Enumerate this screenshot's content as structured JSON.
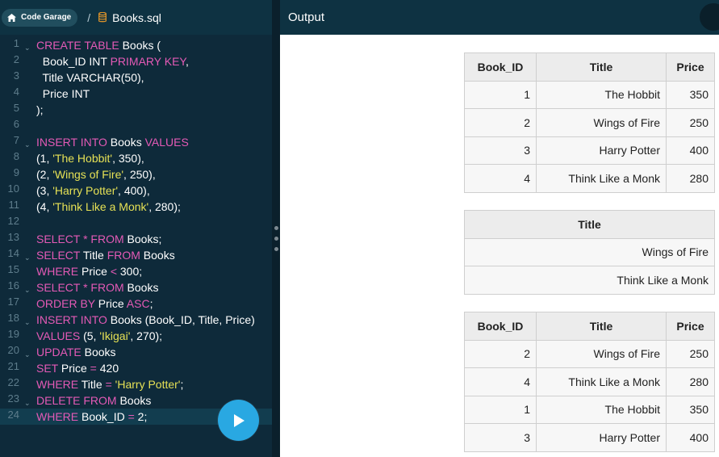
{
  "editor": {
    "project": "Code Garage",
    "separator": "/",
    "file_name": "Books.sql",
    "run_button_label": "Run",
    "active_line": 24
  },
  "code_lines": [
    {
      "n": "1",
      "fold": true,
      "tokens": [
        [
          "kw",
          "CREATE TABLE"
        ],
        [
          "t",
          " Books ("
        ]
      ]
    },
    {
      "n": "2",
      "fold": false,
      "tokens": [
        [
          "t",
          "  Book_ID INT "
        ],
        [
          "kw",
          "PRIMARY KEY"
        ],
        [
          "t",
          ","
        ]
      ]
    },
    {
      "n": "3",
      "fold": false,
      "tokens": [
        [
          "t",
          "  Title VARCHAR(50),"
        ]
      ]
    },
    {
      "n": "4",
      "fold": false,
      "tokens": [
        [
          "t",
          "  Price INT"
        ]
      ]
    },
    {
      "n": "5",
      "fold": false,
      "tokens": [
        [
          "t",
          ");"
        ]
      ]
    },
    {
      "n": "6",
      "fold": false,
      "tokens": []
    },
    {
      "n": "7",
      "fold": true,
      "tokens": [
        [
          "kw",
          "INSERT INTO"
        ],
        [
          "t",
          " Books "
        ],
        [
          "kw",
          "VALUES"
        ]
      ]
    },
    {
      "n": "8",
      "fold": false,
      "tokens": [
        [
          "t",
          "(1, "
        ],
        [
          "str",
          "'The Hobbit'"
        ],
        [
          "t",
          ", 350),"
        ]
      ]
    },
    {
      "n": "9",
      "fold": false,
      "tokens": [
        [
          "t",
          "(2, "
        ],
        [
          "str",
          "'Wings of Fire'"
        ],
        [
          "t",
          ", 250),"
        ]
      ]
    },
    {
      "n": "10",
      "fold": false,
      "tokens": [
        [
          "t",
          "(3, "
        ],
        [
          "str",
          "'Harry Potter'"
        ],
        [
          "t",
          ", 400),"
        ]
      ]
    },
    {
      "n": "11",
      "fold": false,
      "tokens": [
        [
          "t",
          "(4, "
        ],
        [
          "str",
          "'Think Like a Monk'"
        ],
        [
          "t",
          ", 280);"
        ]
      ]
    },
    {
      "n": "12",
      "fold": false,
      "tokens": []
    },
    {
      "n": "13",
      "fold": false,
      "tokens": [
        [
          "kw",
          "SELECT * FROM"
        ],
        [
          "t",
          " Books;"
        ]
      ]
    },
    {
      "n": "14",
      "fold": true,
      "tokens": [
        [
          "kw",
          "SELECT"
        ],
        [
          "t",
          " Title "
        ],
        [
          "kw",
          "FROM"
        ],
        [
          "t",
          " Books"
        ]
      ]
    },
    {
      "n": "15",
      "fold": false,
      "tokens": [
        [
          "kw",
          "WHERE"
        ],
        [
          "t",
          " Price "
        ],
        [
          "kw",
          "<"
        ],
        [
          "t",
          " 300;"
        ]
      ]
    },
    {
      "n": "16",
      "fold": true,
      "tokens": [
        [
          "kw",
          "SELECT * FROM"
        ],
        [
          "t",
          " Books"
        ]
      ]
    },
    {
      "n": "17",
      "fold": false,
      "tokens": [
        [
          "kw",
          "ORDER BY"
        ],
        [
          "t",
          " Price "
        ],
        [
          "kw",
          "ASC"
        ],
        [
          "t",
          ";"
        ]
      ]
    },
    {
      "n": "18",
      "fold": true,
      "tokens": [
        [
          "kw",
          "INSERT INTO"
        ],
        [
          "t",
          " Books (Book_ID, Title, Price)"
        ]
      ]
    },
    {
      "n": "19",
      "fold": false,
      "tokens": [
        [
          "kw",
          "VALUES"
        ],
        [
          "t",
          " (5, "
        ],
        [
          "str",
          "'Ikigai'"
        ],
        [
          "t",
          ", 270);"
        ]
      ]
    },
    {
      "n": "20",
      "fold": true,
      "tokens": [
        [
          "kw",
          "UPDATE"
        ],
        [
          "t",
          " Books"
        ]
      ]
    },
    {
      "n": "21",
      "fold": false,
      "tokens": [
        [
          "kw",
          "SET"
        ],
        [
          "t",
          " Price "
        ],
        [
          "kw",
          "="
        ],
        [
          "t",
          " 420"
        ]
      ]
    },
    {
      "n": "22",
      "fold": false,
      "tokens": [
        [
          "kw",
          "WHERE"
        ],
        [
          "t",
          " Title "
        ],
        [
          "kw",
          "="
        ],
        [
          "t",
          " "
        ],
        [
          "str",
          "'Harry Potter'"
        ],
        [
          "t",
          ";"
        ]
      ]
    },
    {
      "n": "23",
      "fold": true,
      "tokens": [
        [
          "kw",
          "DELETE FROM"
        ],
        [
          "t",
          " Books"
        ]
      ]
    },
    {
      "n": "24",
      "fold": false,
      "tokens": [
        [
          "kw",
          "WHERE"
        ],
        [
          "t",
          " Book_ID "
        ],
        [
          "kw",
          "="
        ],
        [
          "t",
          " 2;"
        ]
      ]
    }
  ],
  "output": {
    "title": "Output",
    "table1": {
      "headers": [
        "Book_ID",
        "Title",
        "Price"
      ],
      "rows": [
        [
          "1",
          "The Hobbit",
          "350"
        ],
        [
          "2",
          "Wings of Fire",
          "250"
        ],
        [
          "3",
          "Harry Potter",
          "400"
        ],
        [
          "4",
          "Think Like a Monk",
          "280"
        ]
      ]
    },
    "table2": {
      "headers": [
        "Title"
      ],
      "rows": [
        [
          "Wings of Fire"
        ],
        [
          "Think Like a Monk"
        ]
      ]
    },
    "table3": {
      "headers": [
        "Book_ID",
        "Title",
        "Price"
      ],
      "rows": [
        [
          "2",
          "Wings of Fire",
          "250"
        ],
        [
          "4",
          "Think Like a Monk",
          "280"
        ],
        [
          "1",
          "The Hobbit",
          "350"
        ],
        [
          "3",
          "Harry Potter",
          "400"
        ]
      ]
    }
  },
  "colors": {
    "editor_bg": "#0e2a3a",
    "header_bg": "#0e3242",
    "keyword": "#e45ab6",
    "string": "#e6e155",
    "run_button": "#29a8e2"
  },
  "icons": [
    "home-icon",
    "database-icon",
    "fold-arrow-icon",
    "play-icon"
  ]
}
